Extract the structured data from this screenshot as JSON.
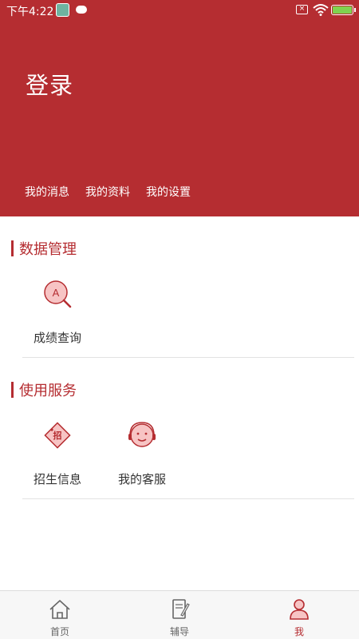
{
  "status_bar": {
    "time": "下午4:22",
    "sim_glyph": "×"
  },
  "header": {
    "login_title": "登录",
    "links": [
      "我的消息",
      "我的资料",
      "我的设置"
    ]
  },
  "sections": [
    {
      "title": "数据管理",
      "items": [
        {
          "label": "成绩查询",
          "icon": "search-grade-icon"
        }
      ]
    },
    {
      "title": "使用服务",
      "items": [
        {
          "label": "招生信息",
          "icon": "enrollment-tag-icon",
          "badge_text": "招"
        },
        {
          "label": "我的客服",
          "icon": "customer-service-icon"
        }
      ]
    }
  ],
  "search_icon_letter": "A",
  "tabbar": {
    "tabs": [
      {
        "label": "首页",
        "icon": "home-icon"
      },
      {
        "label": "辅导",
        "icon": "book-pencil-icon"
      },
      {
        "label": "我",
        "icon": "user-icon",
        "active": true
      }
    ]
  },
  "colors": {
    "brand": "#b52d31",
    "icon_fill": "#f7c4c4",
    "text": "#333333",
    "divider": "#e2e2e2"
  }
}
